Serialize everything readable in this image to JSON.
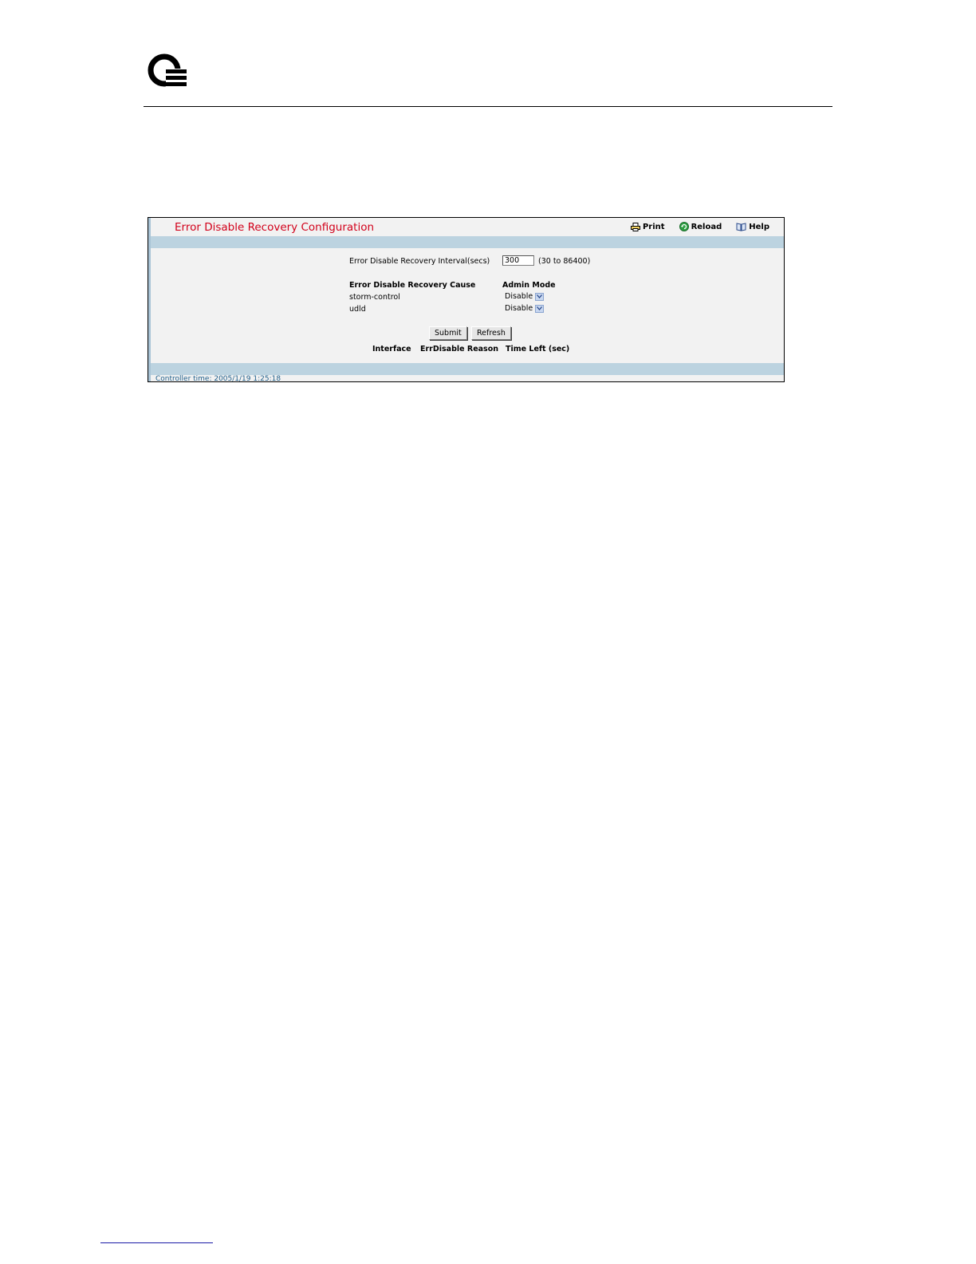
{
  "page": {
    "title": "Error Disable Recovery Configuration",
    "toolbar": {
      "print_label": "Print",
      "reload_label": "Reload",
      "help_label": "Help"
    }
  },
  "form": {
    "interval_label": "Error Disable Recovery Interval(secs)",
    "interval_value": "300",
    "interval_range": "(30 to 86400)",
    "cause_header": "Error Disable Recovery Cause",
    "mode_header": "Admin Mode",
    "causes": [
      {
        "name": "storm-control",
        "mode": "Disable"
      },
      {
        "name": "udld",
        "mode": "Disable"
      }
    ],
    "submit_label": "Submit",
    "refresh_label": "Refresh"
  },
  "table": {
    "headers": [
      "Interface",
      "ErrDisable Reason",
      "Time Left (sec)"
    ]
  },
  "status": {
    "controller_time": "Controller time: 2005/1/19 1:25:18"
  },
  "icons": {
    "logo": "company-logo",
    "print": "printer-icon",
    "reload": "reload-icon",
    "help": "help-book-icon"
  },
  "colors": {
    "title": "#d2001a",
    "band": "#bcd3e0",
    "panel": "#f2f2f2",
    "status_text": "#1f5f8b"
  }
}
